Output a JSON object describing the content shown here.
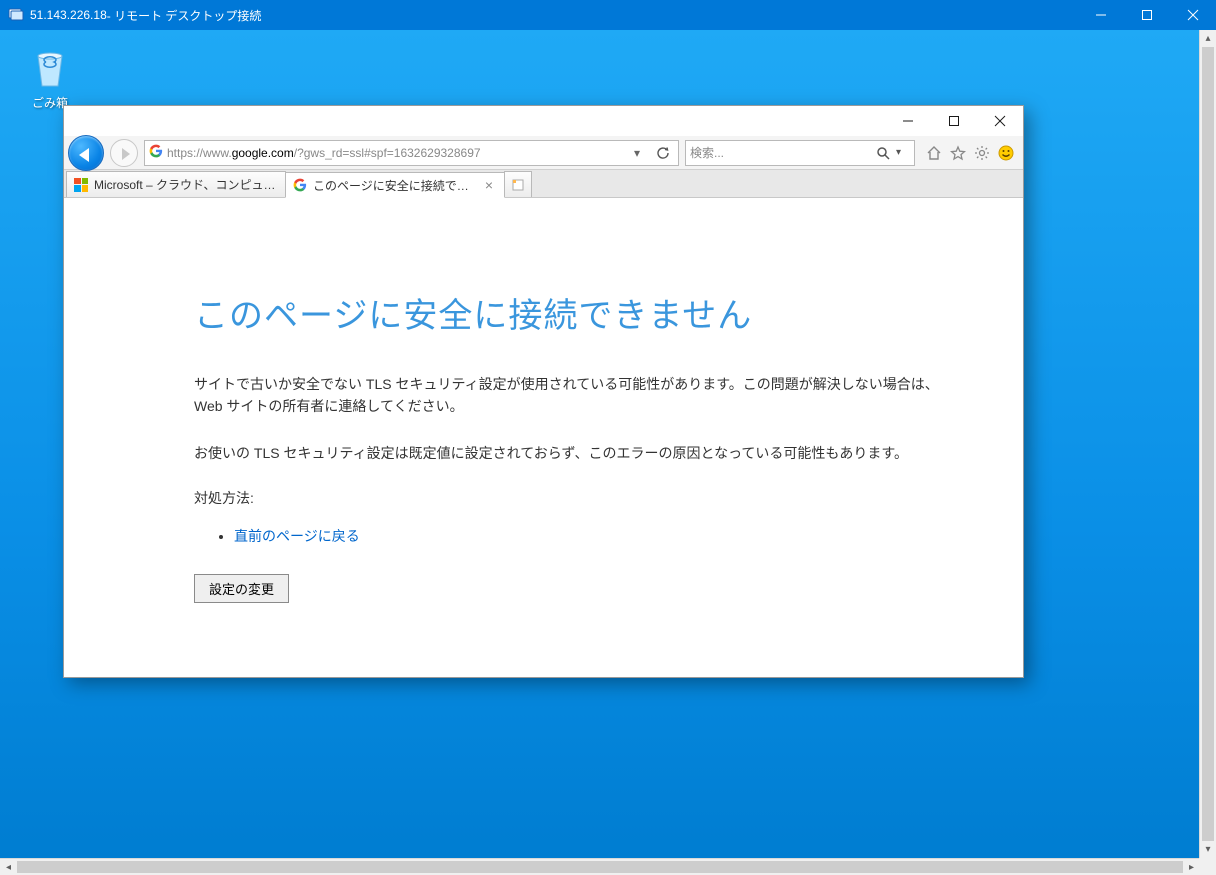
{
  "rdp": {
    "ip": "51.143.226.18",
    "title_suffix": " - リモート デスクトップ接続"
  },
  "desktop": {
    "recycle_bin": "ごみ箱"
  },
  "ie": {
    "address": {
      "prefix": "https://www.",
      "host": "google.com",
      "suffix": "/?gws_rd=ssl#spf=1632629328697"
    },
    "search_placeholder": "検索...",
    "tabs": [
      {
        "title": "Microsoft – クラウド、コンピューター..."
      },
      {
        "title": "このページに安全に接続できません"
      }
    ],
    "error": {
      "heading": "このページに安全に接続できません",
      "p1": "サイトで古いか安全でない TLS セキュリティ設定が使用されている可能性があります。この問題が解決しない場合は、Web サイトの所有者に連絡してください。",
      "p2": "お使いの TLS セキュリティ設定は既定値に設定されておらず、このエラーの原因となっている可能性もあります。",
      "howto": "対処方法:",
      "back_link": "直前のページに戻る",
      "settings_btn": "設定の変更"
    }
  }
}
